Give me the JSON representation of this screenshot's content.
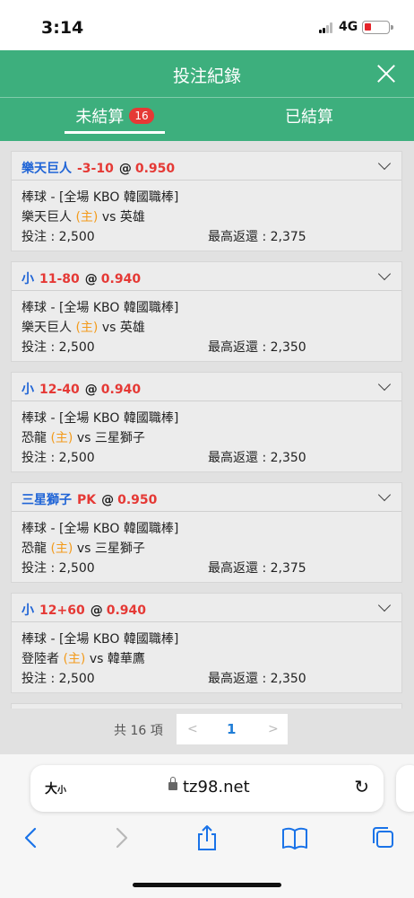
{
  "status": {
    "time": "3:14",
    "network": "4G"
  },
  "header": {
    "title": "投注紀錄"
  },
  "tabs": {
    "unsettled": "未結算",
    "unsettled_count": "16",
    "settled": "已結算"
  },
  "bets": [
    {
      "team": "樂天巨人",
      "line": "-3-10",
      "at": "@",
      "odds": "0.950",
      "sport": "棒球 - [全場 KBO 韓國職棒]",
      "home_team": "樂天巨人",
      "home_tag": "(主)",
      "vs": "vs",
      "away_team": "英雄",
      "stake": "投注 : 2,500",
      "max_return": "最高返還 : 2,375"
    },
    {
      "team": "小",
      "line": "11-80",
      "at": "@",
      "odds": "0.940",
      "sport": "棒球 - [全場 KBO 韓國職棒]",
      "home_team": "樂天巨人",
      "home_tag": "(主)",
      "vs": "vs",
      "away_team": "英雄",
      "stake": "投注 : 2,500",
      "max_return": "最高返還 : 2,350"
    },
    {
      "team": "小",
      "line": "12-40",
      "at": "@",
      "odds": "0.940",
      "sport": "棒球 - [全場 KBO 韓國職棒]",
      "home_team": "恐龍",
      "home_tag": "(主)",
      "vs": "vs",
      "away_team": "三星獅子",
      "stake": "投注 : 2,500",
      "max_return": "最高返還 : 2,350"
    },
    {
      "team": "三星獅子",
      "line": "PK",
      "at": "@",
      "odds": "0.950",
      "sport": "棒球 - [全場 KBO 韓國職棒]",
      "home_team": "恐龍",
      "home_tag": "(主)",
      "vs": "vs",
      "away_team": "三星獅子",
      "stake": "投注 : 2,500",
      "max_return": "最高返還 : 2,375"
    },
    {
      "team": "小",
      "line": "12+60",
      "at": "@",
      "odds": "0.940",
      "sport": "棒球 - [全場 KBO 韓國職棒]",
      "home_team": "登陸者",
      "home_tag": "(主)",
      "vs": "vs",
      "away_team": "韓華鷹",
      "stake": "投注 : 2,500",
      "max_return": "最高返還 : 2,350"
    }
  ],
  "pager": {
    "total": "共 16 項",
    "prev": "<",
    "page": "1",
    "next": ">"
  },
  "browser": {
    "text_size": "大",
    "text_size_small": "小",
    "domain": "tz98.net",
    "reload": "↻"
  },
  "icons": {
    "close": "close-icon",
    "expand": "chevron-down-icon",
    "lock": "lock-icon",
    "back": "back-icon",
    "forward": "forward-icon",
    "share": "share-icon",
    "bookmarks": "bookmarks-icon",
    "tabs": "tabs-icon"
  },
  "colors": {
    "brand": "#3daf7d",
    "team": "#1f64d6",
    "line": "#e53935",
    "home": "#f39a1a",
    "link": "#1f7dd6"
  }
}
